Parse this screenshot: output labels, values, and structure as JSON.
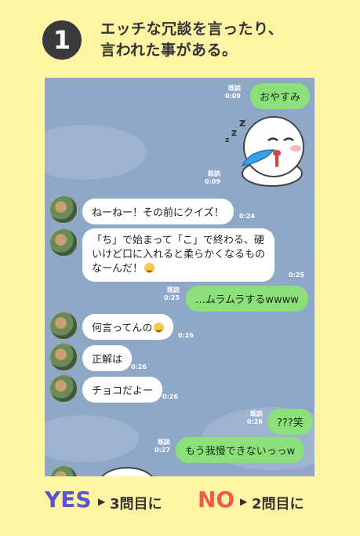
{
  "header": {
    "number": "1",
    "question_lines": [
      "エッチな冗談を言ったり、",
      "言われた事がある。"
    ]
  },
  "chat": {
    "messages": [
      {
        "side": "me",
        "text": "おやすみ",
        "read": "既読",
        "time": "0:09"
      },
      {
        "side": "me",
        "type": "sticker",
        "read": "既読",
        "time": "0:09"
      },
      {
        "side": "them",
        "text": "ねーねー！その前にクイズ！",
        "time": "0:24"
      },
      {
        "side": "them",
        "lines": [
          "「ち」で始まって「こ」で終わる、硬",
          "いけど口に入れると柔らかくなるもの",
          "なーんだ！"
        ],
        "time": "0:25"
      },
      {
        "side": "me",
        "text": "…ムラムラするwwww",
        "read": "既読",
        "time": "0:25"
      },
      {
        "side": "them",
        "text": "何言ってんの",
        "time": "0:26"
      },
      {
        "side": "them",
        "text": "正解は",
        "time": "0:26"
      },
      {
        "side": "them",
        "text": "チョコだよー",
        "time": "0:26"
      },
      {
        "side": "me",
        "text": "???笑",
        "read": "既読",
        "time": "0:26"
      },
      {
        "side": "me",
        "text": "もう我慢できないっっw",
        "read": "既読",
        "time": "0:27"
      }
    ]
  },
  "footer": {
    "yes_label": "YES",
    "yes_dest": "3問目に",
    "no_label": "NO",
    "no_dest": "2問目に",
    "arrow": "▶"
  },
  "colors": {
    "background": "#fff4a3",
    "chat_bg": "#8fa8c8",
    "my_bubble": "#8be07a",
    "yes": "#5a55c8",
    "no": "#f05a4a"
  }
}
